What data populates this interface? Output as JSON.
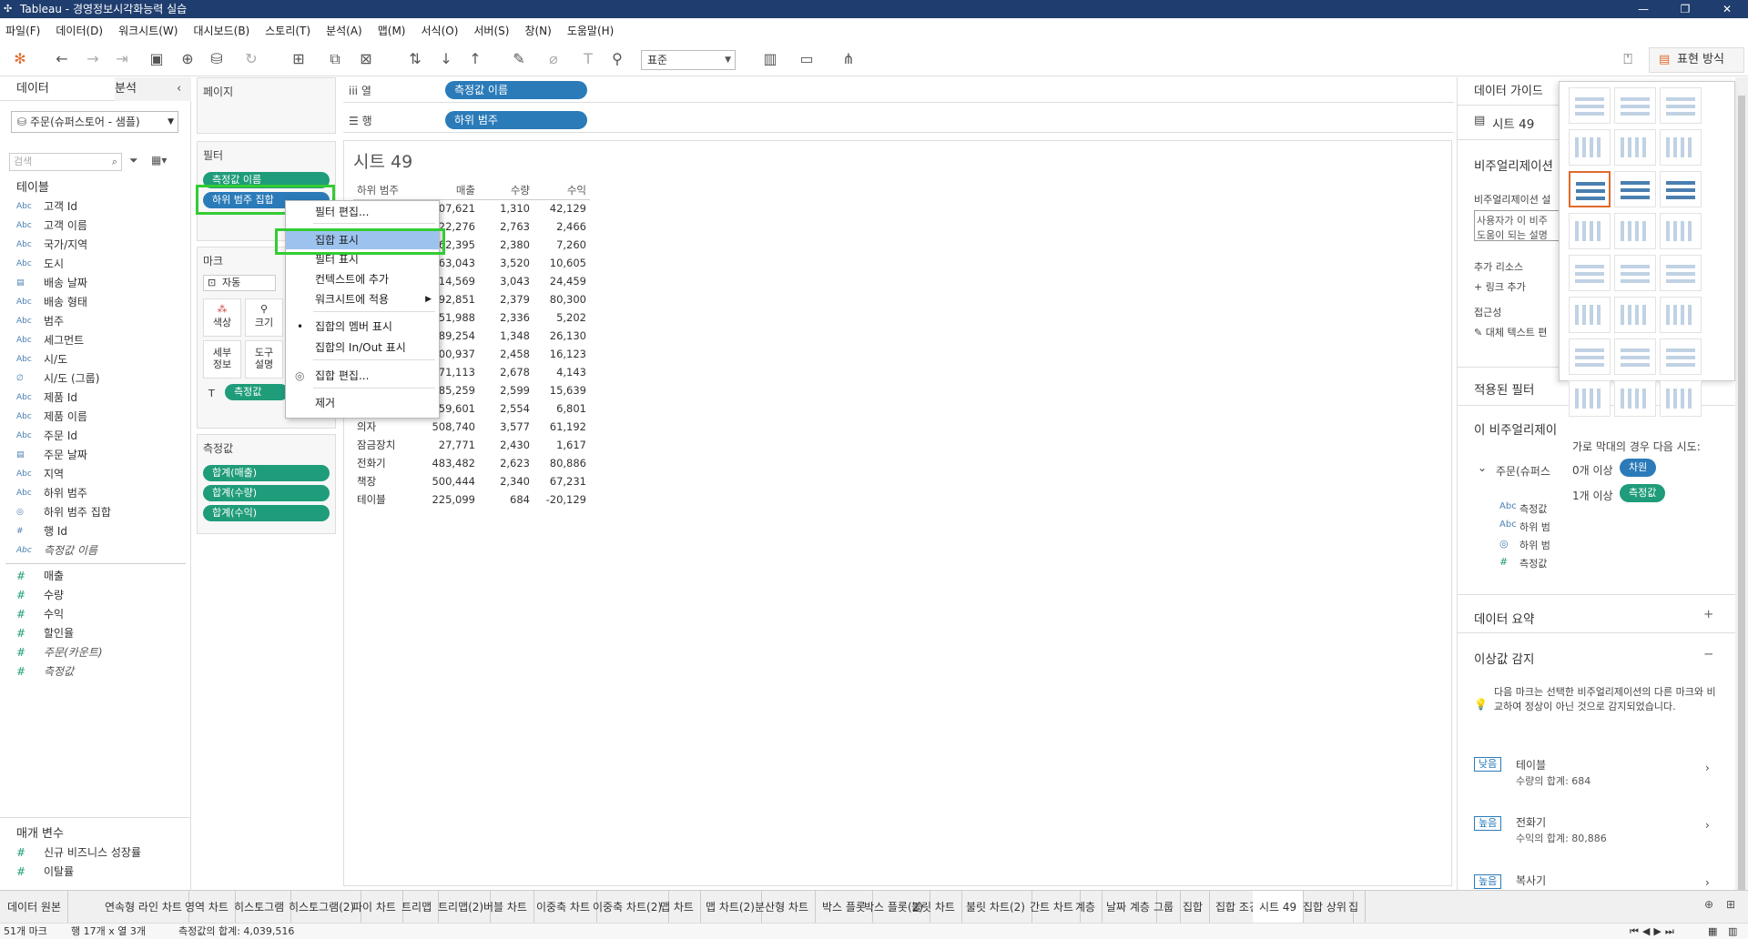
{
  "app": {
    "title": "Tableau - 경영정보시각화능력 실습"
  },
  "menu": [
    "파일(F)",
    "데이터(D)",
    "워크시트(W)",
    "대시보드(B)",
    "스토리(T)",
    "분석(A)",
    "맵(M)",
    "서식(O)",
    "서버(S)",
    "창(N)",
    "도움말(H)"
  ],
  "toolbar": {
    "fit_select": "표준",
    "show_me": "표현 방식"
  },
  "left": {
    "tab_data": "데이터",
    "tab_analysis": "분석",
    "datasource": "주문(슈퍼스토어 - 샘플)",
    "search_placeholder": "검색",
    "tables_header": "테이블",
    "dims": [
      {
        "i": "Abc",
        "n": "고객 Id"
      },
      {
        "i": "Abc",
        "n": "고객 이름"
      },
      {
        "i": "Abc",
        "n": "국가/지역"
      },
      {
        "i": "Abc",
        "n": "도시"
      },
      {
        "i": "▤",
        "n": "배송 날짜"
      },
      {
        "i": "Abc",
        "n": "배송 형태"
      },
      {
        "i": "Abc",
        "n": "범주"
      },
      {
        "i": "Abc",
        "n": "세그먼트"
      },
      {
        "i": "Abc",
        "n": "시/도"
      },
      {
        "i": "∅",
        "n": "시/도 (그룹)"
      },
      {
        "i": "Abc",
        "n": "제품 Id"
      },
      {
        "i": "Abc",
        "n": "제품 이름"
      },
      {
        "i": "Abc",
        "n": "주문 Id"
      },
      {
        "i": "▤",
        "n": "주문 날짜"
      },
      {
        "i": "Abc",
        "n": "지역"
      },
      {
        "i": "Abc",
        "n": "하위 범주"
      },
      {
        "i": "◎",
        "n": "하위 범주 집합"
      },
      {
        "i": "#",
        "n": "행 Id"
      },
      {
        "i": "Abc",
        "n": "측정값 이름",
        "it": true
      }
    ],
    "measures": [
      {
        "n": "매출"
      },
      {
        "n": "수량"
      },
      {
        "n": "수익"
      },
      {
        "n": "할인율"
      },
      {
        "n": "주문(카운트)",
        "it": true
      },
      {
        "n": "측정값",
        "it": true
      }
    ],
    "params_header": "매개 변수",
    "params": [
      "신규 비즈니스 성장률",
      "이탈률"
    ]
  },
  "shelves": {
    "pages": "페이지",
    "filters": "필터",
    "filter_pills": [
      "측정값 이름",
      "하위 범주 집합"
    ],
    "marks": "마크",
    "mark_type": "자동",
    "mark_btns": [
      "색상",
      "크기",
      "세부\n정보",
      "도구\n설명"
    ],
    "mark_pill": "측정값",
    "measure_values": "측정값",
    "mv_pills": [
      "합계(매출)",
      "합계(수량)",
      "합계(수익)"
    ],
    "columns_label": "열",
    "columns_pill": "측정값 이름",
    "rows_label": "행",
    "rows_pill": "하위 범주"
  },
  "sheet": {
    "title": "시트 49",
    "headers": [
      "하위 범주",
      "매출",
      "수량",
      "수익"
    ],
    "rows": [
      [
        "",
        "07,621",
        "1,310",
        "42,129"
      ],
      [
        "",
        "22,276",
        "2,763",
        "2,466"
      ],
      [
        "",
        "62,395",
        "2,380",
        "7,260"
      ],
      [
        "",
        "63,043",
        "3,520",
        "10,605"
      ],
      [
        "",
        "14,569",
        "3,043",
        "24,459"
      ],
      [
        "",
        "92,851",
        "2,379",
        "80,300"
      ],
      [
        "",
        "51,988",
        "2,336",
        "5,202"
      ],
      [
        "",
        "89,254",
        "1,348",
        "26,130"
      ],
      [
        "",
        "00,937",
        "2,458",
        "16,123"
      ],
      [
        "",
        "71,113",
        "2,678",
        "4,143"
      ],
      [
        "",
        "85,259",
        "2,599",
        "15,639"
      ],
      [
        "",
        "59,601",
        "2,554",
        "6,801"
      ],
      [
        "의자",
        "508,740",
        "3,577",
        "61,192"
      ],
      [
        "잠금장치",
        "27,771",
        "2,430",
        "1,617"
      ],
      [
        "전화기",
        "483,482",
        "2,623",
        "80,886"
      ],
      [
        "책장",
        "500,444",
        "2,340",
        "67,231"
      ],
      [
        "테이블",
        "225,099",
        "684",
        "-20,129"
      ]
    ]
  },
  "context_menu": {
    "items": [
      "필터 편집...",
      "집합 표시",
      "필터 표시",
      "컨텍스트에 추가",
      "워크시트에 적용",
      "집합의 멤버 표시",
      "집합의 In/Out 표시",
      "집합 편집...",
      "제거"
    ]
  },
  "guide": {
    "header": "데이터 가이드",
    "sheet": "시트 49",
    "viz_desc_head": "비주얼리제이션",
    "viz_desc_sub": "비주얼리제이션 설",
    "viz_desc_box": "사용자가 이 비주\n도움이 되는 설명",
    "extra_res": "추가 리소스",
    "add_link": "링크 추가",
    "access": "접근성",
    "alt_text": "대체 텍스트 편",
    "applied_filters": "적용된 필터",
    "this_viz": "이 비주얼리제이",
    "source": "주문(슈퍼스",
    "src_fields": [
      "측정값",
      "하위 범",
      "하위 범",
      "측정값"
    ],
    "data_summary": "데이터 요약",
    "outlier": "이상값 감지",
    "outlier_desc": "다음 마크는 선택한 비주얼리제이션의 다른 마크와 비교하여 정상이 아닌 것으로 감지되었습니다.",
    "outliers": [
      {
        "badge": "낮음",
        "name": "테이블",
        "detail": "수량의 합계: 684"
      },
      {
        "badge": "높음",
        "name": "전화기",
        "detail": "수익의 합계: 80,886"
      },
      {
        "badge": "높음",
        "name": "복사기",
        "detail": ""
      }
    ]
  },
  "showme": {
    "hint": "가로 막대의 경우 다음 시도:",
    "req1": "0개 이상",
    "req1pill": "차원",
    "req2": "1개 이상",
    "req2pill": "측정값"
  },
  "tabs": [
    "데이터 원본",
    "연속형 라인 차트",
    "영역 차트",
    "히스토그램",
    "히스토그램(2)",
    "파이 차트",
    "트리맵",
    "트리맵(2)",
    "버블 차트",
    "이중축 차트",
    "이중축 차트(2)",
    "맵 차트",
    "맵 차트(2)",
    "분산형 차트",
    "박스 플롯",
    "박스 플롯(2)",
    "불릿 차트",
    "불릿 차트(2)",
    "간트 차트",
    "계층",
    "날짜 계층",
    "그룹",
    "집합",
    "집합 조건",
    "시트 49",
    "집합 상위",
    "집"
  ],
  "status": {
    "marks": "51개 마크",
    "rows": "행 17개 x 열 3개",
    "sum": "측정값의 합계: 4,039,516"
  },
  "colors": {
    "measure": "#1f9c7a",
    "dimension": "#2b7bb9",
    "highlight": "#33cc33",
    "titlebar": "#1f3d6e"
  }
}
